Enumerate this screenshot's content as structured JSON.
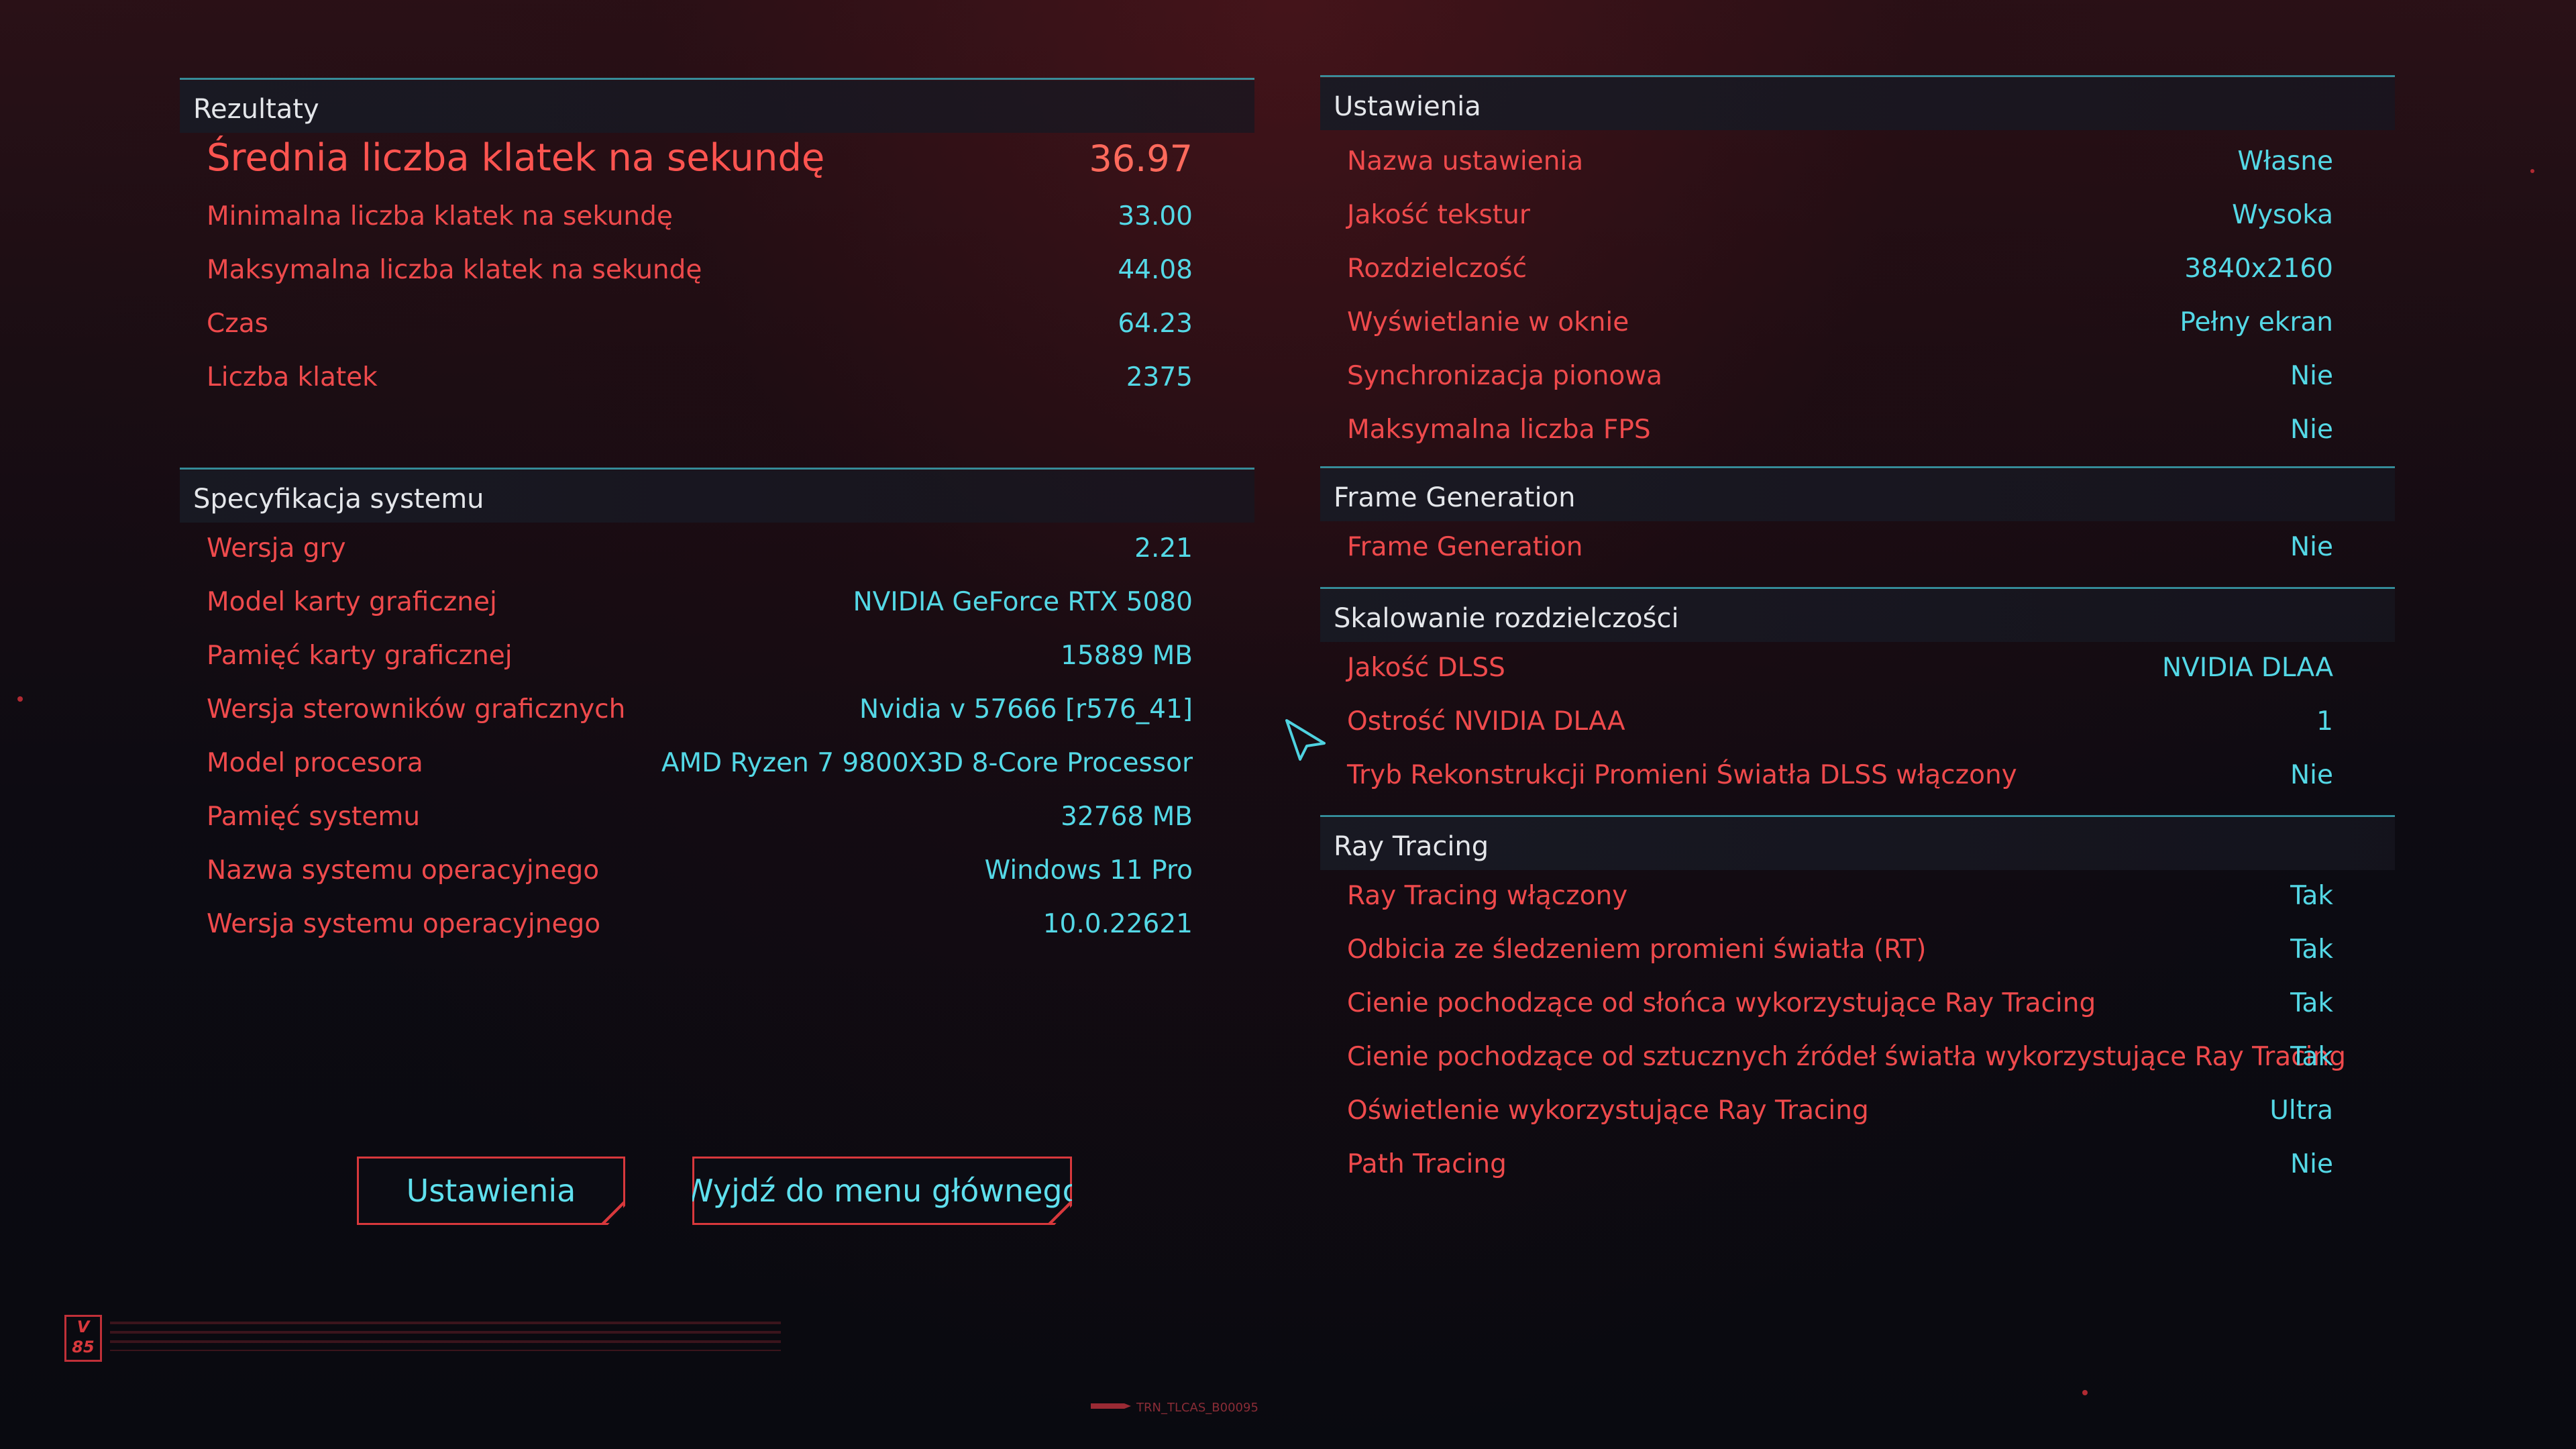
{
  "results": {
    "title": "Rezultaty",
    "rows": [
      {
        "label": "Średnia liczba klatek na sekundę",
        "value": "36.97"
      },
      {
        "label": "Minimalna liczba klatek na sekundę",
        "value": "33.00"
      },
      {
        "label": "Maksymalna liczba klatek na sekundę",
        "value": "44.08"
      },
      {
        "label": "Czas",
        "value": "64.23"
      },
      {
        "label": "Liczba klatek",
        "value": "2375"
      }
    ]
  },
  "system": {
    "title": "Specyfikacja systemu",
    "rows": [
      {
        "label": "Wersja gry",
        "value": "2.21"
      },
      {
        "label": "Model karty graficznej",
        "value": "NVIDIA GeForce RTX 5080"
      },
      {
        "label": "Pamięć karty graficznej",
        "value": "15889 MB"
      },
      {
        "label": "Wersja sterowników graficznych",
        "value": "Nvidia v 57666 [r576_41]"
      },
      {
        "label": "Model procesora",
        "value": "AMD Ryzen 7 9800X3D 8-Core Processor"
      },
      {
        "label": "Pamięć systemu",
        "value": "32768 MB"
      },
      {
        "label": "Nazwa systemu operacyjnego",
        "value": "Windows 11 Pro"
      },
      {
        "label": "Wersja systemu operacyjnego",
        "value": "10.0.22621"
      }
    ]
  },
  "settings": {
    "title": "Ustawienia",
    "rows": [
      {
        "label": "Nazwa ustawienia",
        "value": "Własne"
      },
      {
        "label": "Jakość tekstur",
        "value": "Wysoka"
      },
      {
        "label": "Rozdzielczość",
        "value": "3840x2160"
      },
      {
        "label": "Wyświetlanie w oknie",
        "value": "Pełny ekran"
      },
      {
        "label": "Synchronizacja pionowa",
        "value": "Nie"
      },
      {
        "label": "Maksymalna liczba FPS",
        "value": "Nie"
      }
    ]
  },
  "frame_generation": {
    "title": "Frame Generation",
    "rows": [
      {
        "label": "Frame Generation",
        "value": "Nie"
      }
    ]
  },
  "scaling": {
    "title": "Skalowanie rozdzielczości",
    "rows": [
      {
        "label": "Jakość DLSS",
        "value": "NVIDIA DLAA"
      },
      {
        "label": "Ostrość NVIDIA DLAA",
        "value": "1"
      },
      {
        "label": "Tryb Rekonstrukcji Promieni Światła DLSS włączony",
        "value": "Nie"
      }
    ]
  },
  "ray_tracing": {
    "title": "Ray Tracing",
    "rows": [
      {
        "label": "Ray Tracing włączony",
        "value": "Tak"
      },
      {
        "label": "Odbicia ze śledzeniem promieni światła (RT)",
        "value": "Tak"
      },
      {
        "label": "Cienie pochodzące od słońca wykorzystujące Ray Tracing",
        "value": "Tak"
      },
      {
        "label": "Cienie pochodzące od sztucznych źródeł światła wykorzystujące Ray Tracing",
        "value": "Tak"
      },
      {
        "label": "Oświetlenie wykorzystujące Ray Tracing",
        "value": "Ultra"
      },
      {
        "label": "Path Tracing",
        "value": "Nie"
      }
    ]
  },
  "buttons": {
    "settings_label": "Ustawienia",
    "exit_label": "Wyjdź do menu głównego"
  },
  "footer": {
    "logo_text": "V 85",
    "build_id": "TRN_TLCAS_B00095"
  },
  "icons": {
    "cursor": "pointer-arrow-icon"
  },
  "colors": {
    "label_red": "#ef4a4c",
    "value_cyan": "#54d8e6",
    "divider_teal": "#3aa2b0",
    "header_text": "#e4e6ea",
    "button_border": "#d8383c"
  }
}
